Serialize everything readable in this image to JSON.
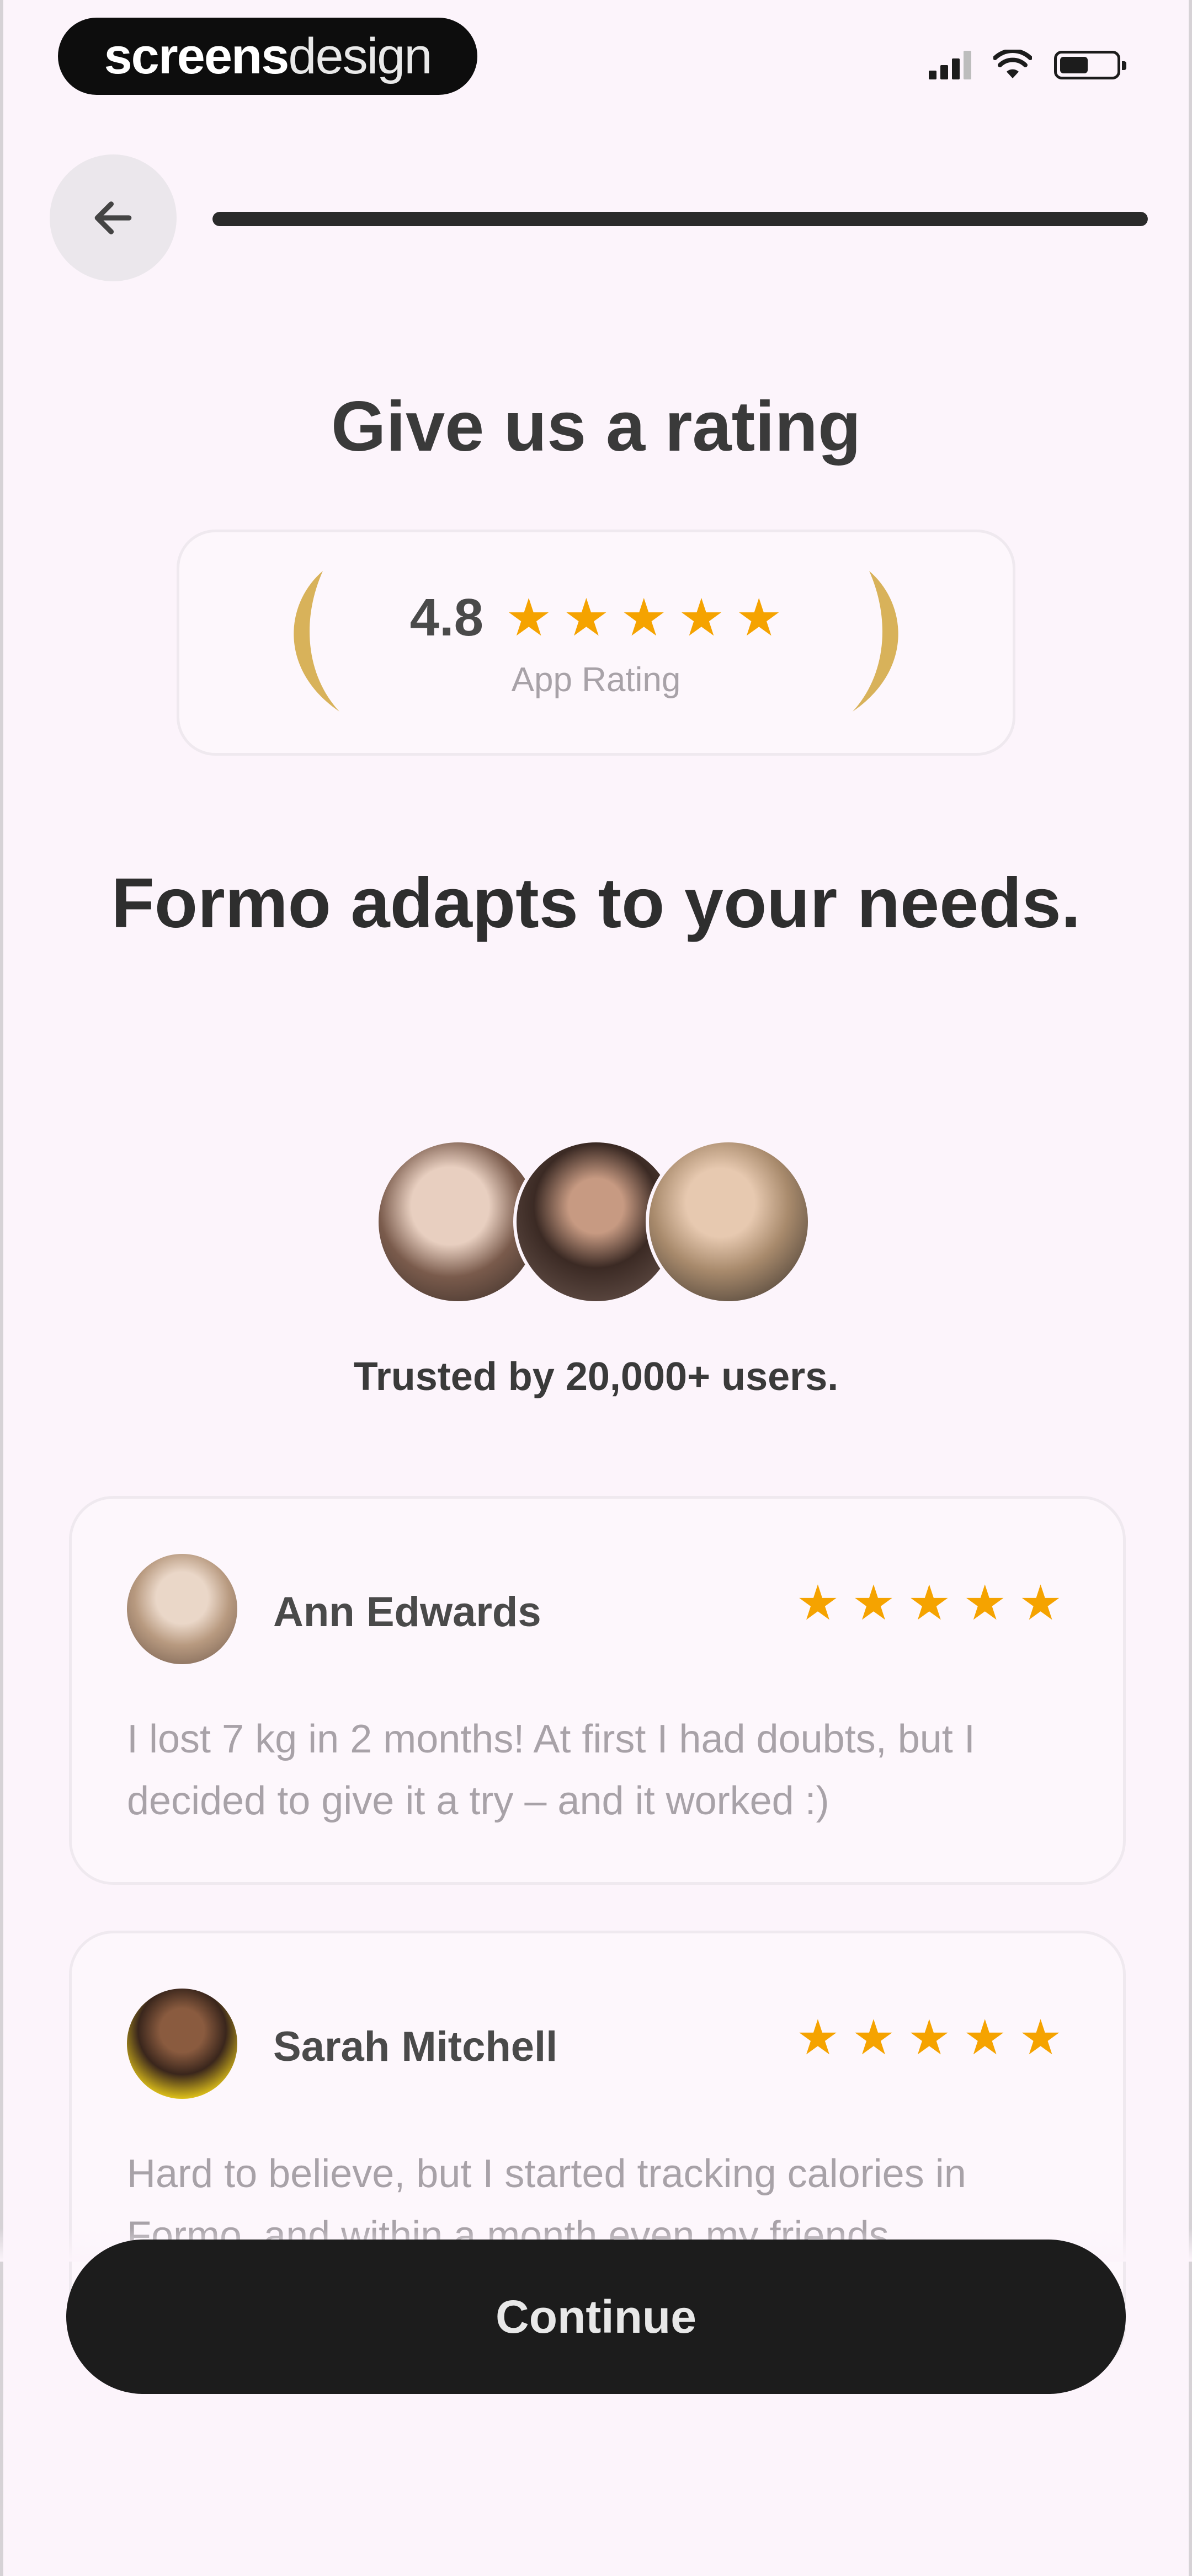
{
  "status_bar": {
    "brand_bold": "screens",
    "brand_light": "design"
  },
  "header": {
    "progress": 1.0
  },
  "title": "Give us a rating",
  "rating_card": {
    "value": "4.8",
    "stars": 5,
    "label": "App Rating"
  },
  "headline": "Formo adapts to your needs.",
  "social_proof": {
    "text": "Trusted by 20,000+ users."
  },
  "reviews": [
    {
      "name": "Ann Edwards",
      "stars": 5,
      "text": "I lost 7 kg in 2 months! At first I had doubts, but I decided to give it a try – and it worked :)"
    },
    {
      "name": "Sarah Mitchell",
      "stars": 5,
      "text": "Hard to believe, but I started tracking calories in Formo, and within a month even my friends"
    }
  ],
  "cta": {
    "label": "Continue"
  },
  "colors": {
    "background": "#fcf4fb",
    "star": "#f5a300",
    "button": "#1c1c1c"
  }
}
